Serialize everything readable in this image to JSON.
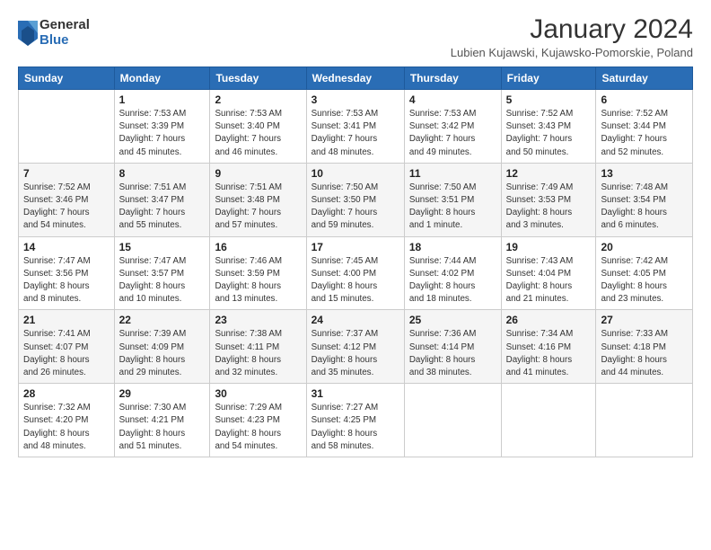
{
  "logo": {
    "general": "General",
    "blue": "Blue"
  },
  "title": "January 2024",
  "location": "Lubien Kujawski, Kujawsko-Pomorskie, Poland",
  "days_header": [
    "Sunday",
    "Monday",
    "Tuesday",
    "Wednesday",
    "Thursday",
    "Friday",
    "Saturday"
  ],
  "weeks": [
    [
      {
        "day": "",
        "info": ""
      },
      {
        "day": "1",
        "info": "Sunrise: 7:53 AM\nSunset: 3:39 PM\nDaylight: 7 hours\nand 45 minutes."
      },
      {
        "day": "2",
        "info": "Sunrise: 7:53 AM\nSunset: 3:40 PM\nDaylight: 7 hours\nand 46 minutes."
      },
      {
        "day": "3",
        "info": "Sunrise: 7:53 AM\nSunset: 3:41 PM\nDaylight: 7 hours\nand 48 minutes."
      },
      {
        "day": "4",
        "info": "Sunrise: 7:53 AM\nSunset: 3:42 PM\nDaylight: 7 hours\nand 49 minutes."
      },
      {
        "day": "5",
        "info": "Sunrise: 7:52 AM\nSunset: 3:43 PM\nDaylight: 7 hours\nand 50 minutes."
      },
      {
        "day": "6",
        "info": "Sunrise: 7:52 AM\nSunset: 3:44 PM\nDaylight: 7 hours\nand 52 minutes."
      }
    ],
    [
      {
        "day": "7",
        "info": "Sunrise: 7:52 AM\nSunset: 3:46 PM\nDaylight: 7 hours\nand 54 minutes."
      },
      {
        "day": "8",
        "info": "Sunrise: 7:51 AM\nSunset: 3:47 PM\nDaylight: 7 hours\nand 55 minutes."
      },
      {
        "day": "9",
        "info": "Sunrise: 7:51 AM\nSunset: 3:48 PM\nDaylight: 7 hours\nand 57 minutes."
      },
      {
        "day": "10",
        "info": "Sunrise: 7:50 AM\nSunset: 3:50 PM\nDaylight: 7 hours\nand 59 minutes."
      },
      {
        "day": "11",
        "info": "Sunrise: 7:50 AM\nSunset: 3:51 PM\nDaylight: 8 hours\nand 1 minute."
      },
      {
        "day": "12",
        "info": "Sunrise: 7:49 AM\nSunset: 3:53 PM\nDaylight: 8 hours\nand 3 minutes."
      },
      {
        "day": "13",
        "info": "Sunrise: 7:48 AM\nSunset: 3:54 PM\nDaylight: 8 hours\nand 6 minutes."
      }
    ],
    [
      {
        "day": "14",
        "info": "Sunrise: 7:47 AM\nSunset: 3:56 PM\nDaylight: 8 hours\nand 8 minutes."
      },
      {
        "day": "15",
        "info": "Sunrise: 7:47 AM\nSunset: 3:57 PM\nDaylight: 8 hours\nand 10 minutes."
      },
      {
        "day": "16",
        "info": "Sunrise: 7:46 AM\nSunset: 3:59 PM\nDaylight: 8 hours\nand 13 minutes."
      },
      {
        "day": "17",
        "info": "Sunrise: 7:45 AM\nSunset: 4:00 PM\nDaylight: 8 hours\nand 15 minutes."
      },
      {
        "day": "18",
        "info": "Sunrise: 7:44 AM\nSunset: 4:02 PM\nDaylight: 8 hours\nand 18 minutes."
      },
      {
        "day": "19",
        "info": "Sunrise: 7:43 AM\nSunset: 4:04 PM\nDaylight: 8 hours\nand 21 minutes."
      },
      {
        "day": "20",
        "info": "Sunrise: 7:42 AM\nSunset: 4:05 PM\nDaylight: 8 hours\nand 23 minutes."
      }
    ],
    [
      {
        "day": "21",
        "info": "Sunrise: 7:41 AM\nSunset: 4:07 PM\nDaylight: 8 hours\nand 26 minutes."
      },
      {
        "day": "22",
        "info": "Sunrise: 7:39 AM\nSunset: 4:09 PM\nDaylight: 8 hours\nand 29 minutes."
      },
      {
        "day": "23",
        "info": "Sunrise: 7:38 AM\nSunset: 4:11 PM\nDaylight: 8 hours\nand 32 minutes."
      },
      {
        "day": "24",
        "info": "Sunrise: 7:37 AM\nSunset: 4:12 PM\nDaylight: 8 hours\nand 35 minutes."
      },
      {
        "day": "25",
        "info": "Sunrise: 7:36 AM\nSunset: 4:14 PM\nDaylight: 8 hours\nand 38 minutes."
      },
      {
        "day": "26",
        "info": "Sunrise: 7:34 AM\nSunset: 4:16 PM\nDaylight: 8 hours\nand 41 minutes."
      },
      {
        "day": "27",
        "info": "Sunrise: 7:33 AM\nSunset: 4:18 PM\nDaylight: 8 hours\nand 44 minutes."
      }
    ],
    [
      {
        "day": "28",
        "info": "Sunrise: 7:32 AM\nSunset: 4:20 PM\nDaylight: 8 hours\nand 48 minutes."
      },
      {
        "day": "29",
        "info": "Sunrise: 7:30 AM\nSunset: 4:21 PM\nDaylight: 8 hours\nand 51 minutes."
      },
      {
        "day": "30",
        "info": "Sunrise: 7:29 AM\nSunset: 4:23 PM\nDaylight: 8 hours\nand 54 minutes."
      },
      {
        "day": "31",
        "info": "Sunrise: 7:27 AM\nSunset: 4:25 PM\nDaylight: 8 hours\nand 58 minutes."
      },
      {
        "day": "",
        "info": ""
      },
      {
        "day": "",
        "info": ""
      },
      {
        "day": "",
        "info": ""
      }
    ]
  ]
}
